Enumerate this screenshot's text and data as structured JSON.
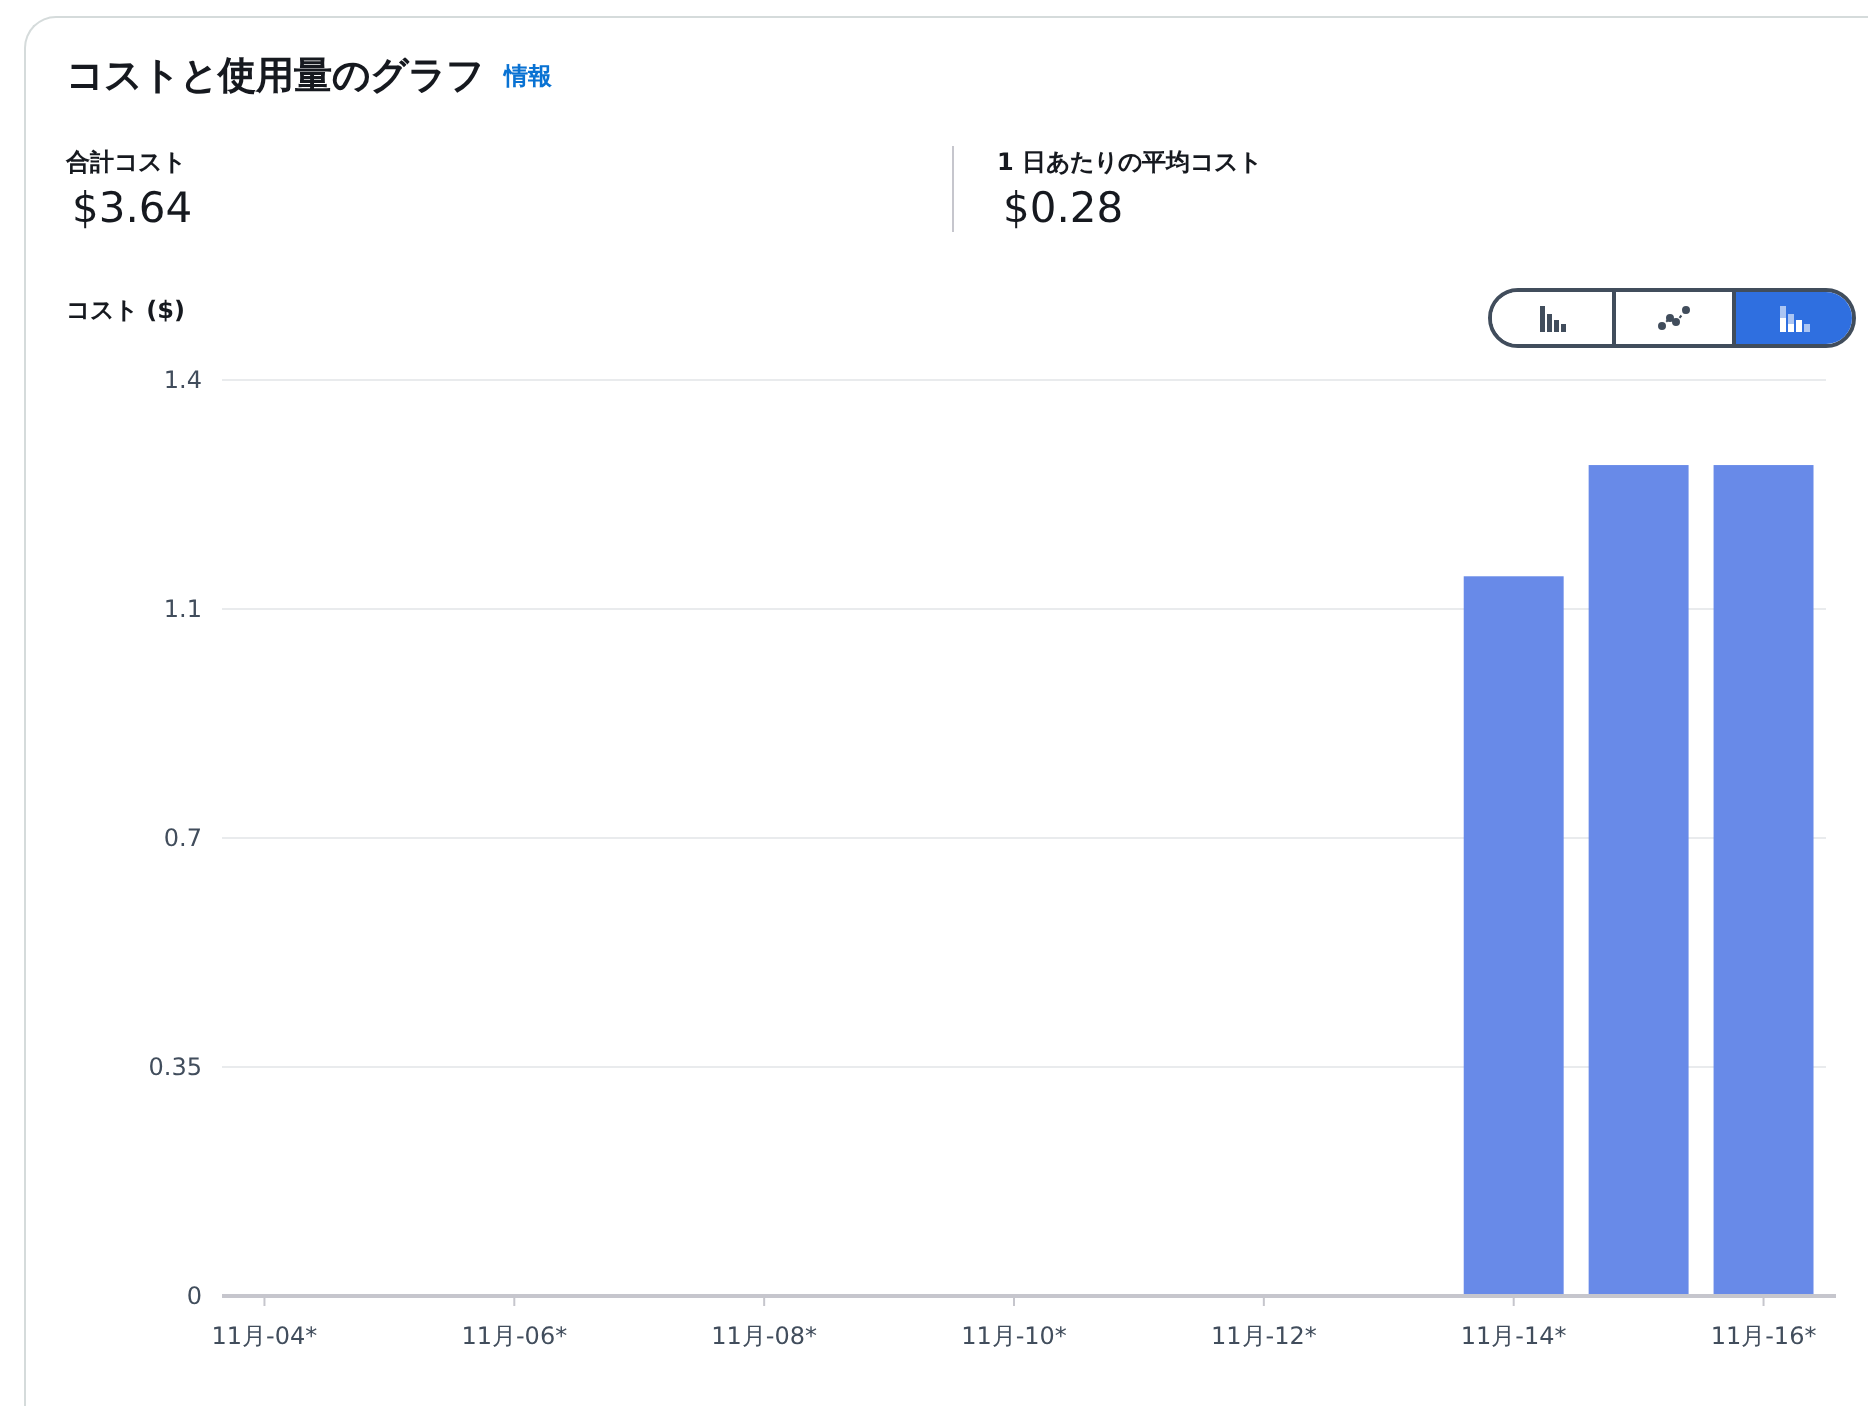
{
  "title": "コストと使用量のグラフ",
  "info_link": "情報",
  "summary": [
    {
      "label": "合計コスト",
      "value": "$3.64"
    },
    {
      "label": "1 日あたりの平均コスト",
      "value": "$0.28"
    }
  ],
  "chart_type_buttons": [
    {
      "kind": "bar",
      "selected": false
    },
    {
      "kind": "line",
      "selected": false
    },
    {
      "kind": "stacked",
      "selected": true
    }
  ],
  "chart_data": {
    "type": "bar",
    "ylabel": "コスト ($)",
    "grid": true,
    "categories": [
      "11月-04*",
      null,
      "11月-06*",
      null,
      "11月-08*",
      null,
      "11月-10*",
      null,
      "11月-12*",
      null,
      "11月-14*",
      null,
      "11月-16*"
    ],
    "series": [
      {
        "color": "#688ae8",
        "values": [
          0,
          0,
          0,
          0,
          0,
          0,
          0,
          0,
          0,
          0,
          1.1,
          1.27,
          1.27
        ]
      }
    ],
    "ylim": [
      0,
      1.4
    ],
    "yticks": [
      0,
      {
        "value": 0.35,
        "label": "0.35"
      },
      {
        "value": 0.7,
        "label": "0.7"
      },
      {
        "value": 1.05,
        "label": "1.1"
      },
      {
        "value": 1.4,
        "label": "1.4"
      }
    ]
  }
}
